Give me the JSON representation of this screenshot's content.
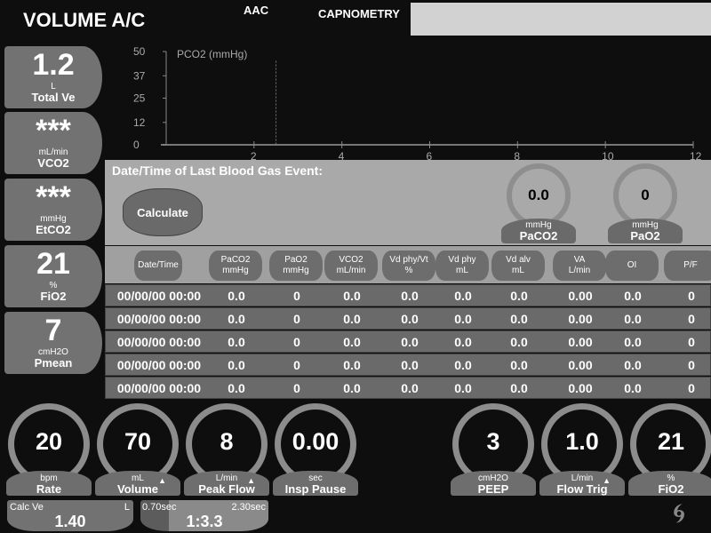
{
  "header": {
    "mode": "VOLUME A/C",
    "tab_aac": "AAC",
    "tab_capnometry": "CAPNOMETRY"
  },
  "tiles": [
    {
      "value": "1.2",
      "unit": "L",
      "name": "Total Ve"
    },
    {
      "value": "***",
      "unit": "mL/min",
      "name": "VCO2"
    },
    {
      "value": "***",
      "unit": "mmHg",
      "name": "EtCO2"
    },
    {
      "value": "21",
      "unit": "%",
      "name": "FiO2"
    },
    {
      "value": "7",
      "unit": "cmH2O",
      "name": "Pmean"
    }
  ],
  "chart_data": {
    "type": "line",
    "title": "PCO2 (mmHg)",
    "yticks": [
      "50",
      "37",
      "25",
      "12",
      "0"
    ],
    "xticks": [
      "2",
      "4",
      "6",
      "8",
      "10",
      "12"
    ],
    "xlim": [
      0,
      12
    ],
    "ylim": [
      0,
      50
    ],
    "series": []
  },
  "blood_gas": {
    "title": "Date/Time of Last Blood Gas Event:",
    "calculate_label": "Calculate",
    "dials": [
      {
        "value": "0.0",
        "unit": "mmHg",
        "name": "PaCO2"
      },
      {
        "value": "0",
        "unit": "mmHg",
        "name": "PaO2"
      }
    ]
  },
  "table": {
    "headers": [
      [
        "Date/Time",
        ""
      ],
      [
        "PaCO2",
        "mmHg"
      ],
      [
        "PaO2",
        "mmHg"
      ],
      [
        "VCO2",
        "mL/min"
      ],
      [
        "Vd phy/Vt",
        "%"
      ],
      [
        "Vd phy",
        "mL"
      ],
      [
        "Vd alv",
        "mL"
      ],
      [
        "VA",
        "L/min"
      ],
      [
        "OI",
        ""
      ],
      [
        "P/F",
        ""
      ]
    ],
    "rows": [
      [
        "00/00/00 00:00",
        "0.0",
        "0",
        "0.0",
        "0.0",
        "0.0",
        "0.0",
        "0.00",
        "0.0",
        "0"
      ],
      [
        "00/00/00 00:00",
        "0.0",
        "0",
        "0.0",
        "0.0",
        "0.0",
        "0.0",
        "0.00",
        "0.0",
        "0"
      ],
      [
        "00/00/00 00:00",
        "0.0",
        "0",
        "0.0",
        "0.0",
        "0.0",
        "0.0",
        "0.00",
        "0.0",
        "0"
      ],
      [
        "00/00/00 00:00",
        "0.0",
        "0",
        "0.0",
        "0.0",
        "0.0",
        "0.0",
        "0.00",
        "0.0",
        "0"
      ],
      [
        "00/00/00 00:00",
        "0.0",
        "0",
        "0.0",
        "0.0",
        "0.0",
        "0.0",
        "0.00",
        "0.0",
        "0"
      ]
    ]
  },
  "settings": [
    {
      "value": "20",
      "unit": "bpm",
      "name": "Rate",
      "tri": false
    },
    {
      "value": "70",
      "unit": "mL",
      "name": "Volume",
      "tri": true
    },
    {
      "value": "8",
      "unit": "L/min",
      "name": "Peak Flow",
      "tri": true
    },
    {
      "value": "0.00",
      "unit": "sec",
      "name": "Insp Pause",
      "tri": false
    },
    {
      "value": "3",
      "unit": "cmH2O",
      "name": "PEEP",
      "tri": false
    },
    {
      "value": "1.0",
      "unit": "L/min",
      "name": "Flow Trig",
      "tri": true
    },
    {
      "value": "21",
      "unit": "%",
      "name": "FiO2",
      "tri": false
    }
  ],
  "calc_ve": {
    "label": "Calc Ve",
    "unit": "L",
    "value": "1.40"
  },
  "ie": {
    "insp": "0.70sec",
    "exp": "2.30sec",
    "ratio": "1:3.3"
  },
  "icons": {
    "logo": "spiral-logo",
    "tri": "alarm-triangle-icon"
  }
}
